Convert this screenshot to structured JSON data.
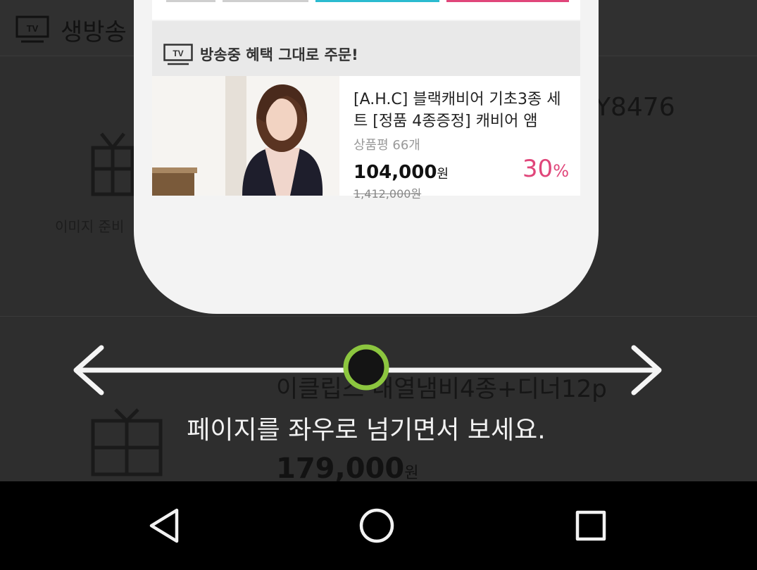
{
  "background_screen": {
    "header_title": "생방송",
    "product_code": "Y8476",
    "image_placeholder_label": "이미지 준비",
    "second_product": {
      "name": "이클립스 내열냄비4종+디너12p",
      "price": "179,000",
      "price_unit": "원"
    }
  },
  "phone_preview": {
    "section_title": "방송중 혜택 그대로 주문!",
    "tv_icon_label": "TV",
    "product": {
      "name": "[A.H.C] 블랙캐비어 기초3종 세트 [정품 4종증정] 캐비어 앰",
      "review_count": "상품평 66개",
      "price": "104,000",
      "price_unit": "원",
      "original_price": "1,412,000원",
      "discount": "30",
      "discount_unit": "%"
    },
    "top_segment_colors": [
      "#cfcfcf",
      "#cfcfcf",
      "#2bbbd0",
      "#e0467a"
    ]
  },
  "swipe_hint": {
    "message": "페이지를 좌우로 넘기면서 보세요.",
    "accent_color": "#8cc63f",
    "icons": [
      "arrow-left-icon",
      "arrow-right-icon"
    ]
  },
  "navigation_bar": {
    "buttons": [
      "back-icon",
      "home-icon",
      "recents-icon"
    ]
  }
}
